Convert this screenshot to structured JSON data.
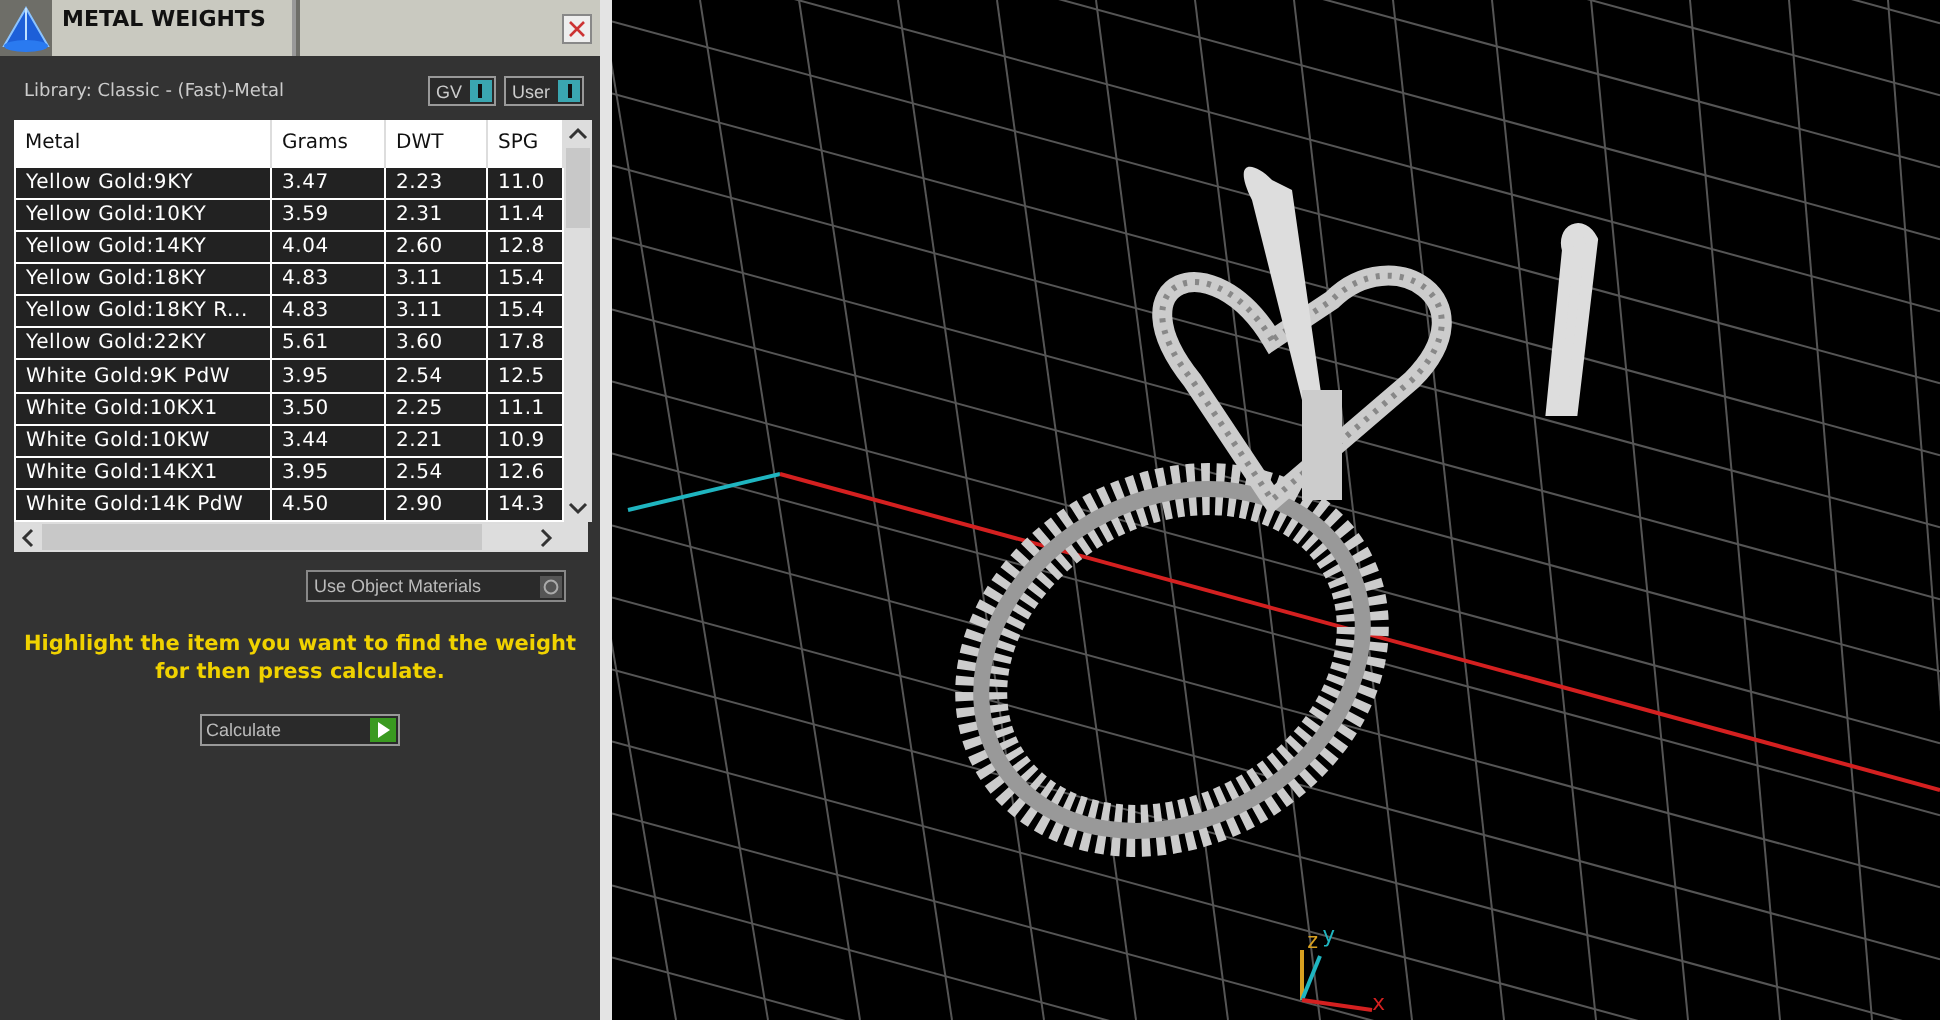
{
  "panel": {
    "title": "METAL WEIGHTS",
    "library": "Library: Classic - (Fast)-Metal",
    "toggles": [
      {
        "label": "GV",
        "on": true
      },
      {
        "label": "User",
        "on": true
      }
    ],
    "table": {
      "columns": [
        "Metal",
        "Grams",
        "DWT",
        "SPG"
      ],
      "rows": [
        [
          "Yellow Gold:9KY",
          "3.47",
          "2.23",
          "11.0"
        ],
        [
          "Yellow Gold:10KY",
          "3.59",
          "2.31",
          "11.4"
        ],
        [
          "Yellow Gold:14KY",
          "4.04",
          "2.60",
          "12.8"
        ],
        [
          "Yellow Gold:18KY",
          "4.83",
          "3.11",
          "15.4"
        ],
        [
          "Yellow Gold:18KY R...",
          "4.83",
          "3.11",
          "15.4"
        ],
        [
          "Yellow Gold:22KY",
          "5.61",
          "3.60",
          "17.8"
        ],
        [
          "White Gold:9K PdW",
          "3.95",
          "2.54",
          "12.5"
        ],
        [
          "White Gold:10KX1",
          "3.50",
          "2.25",
          "11.1"
        ],
        [
          "White Gold:10KW",
          "3.44",
          "2.21",
          "10.9"
        ],
        [
          "White Gold:14KX1",
          "3.95",
          "2.54",
          "12.6"
        ],
        [
          "White Gold:14K PdW",
          "4.50",
          "2.90",
          "14.3"
        ]
      ]
    },
    "use_object_materials": {
      "label": "Use Object Materials",
      "on": false
    },
    "hint": "Highlight the item you want to find the weight for then press calculate.",
    "calculate_button": "Calculate"
  },
  "viewport": {
    "axis_labels": [
      "z",
      "y",
      "x"
    ]
  }
}
